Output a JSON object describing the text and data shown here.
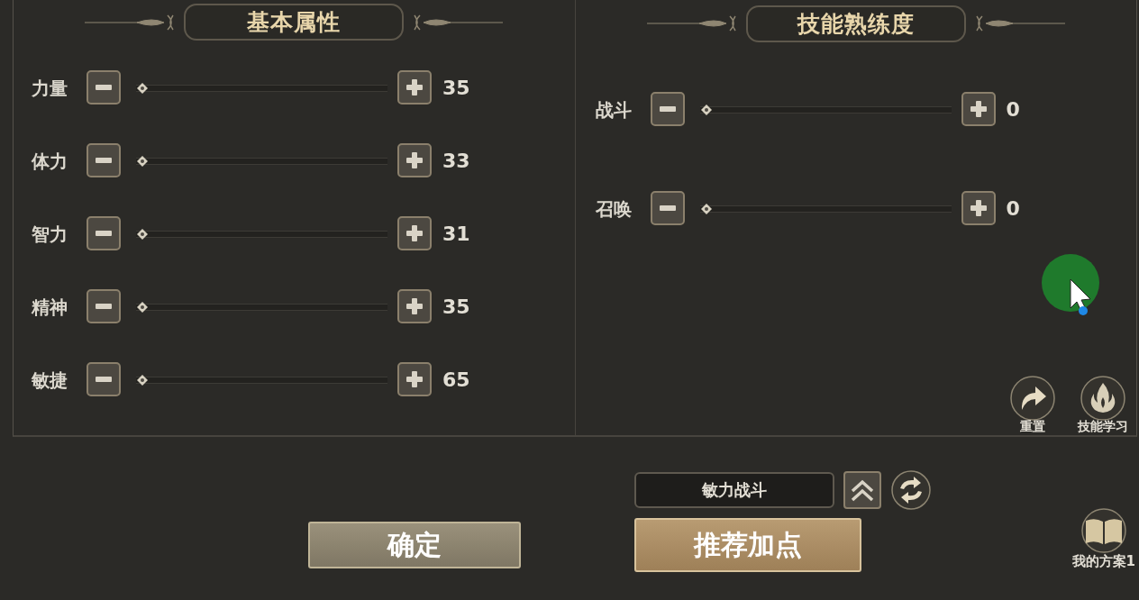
{
  "panels": [
    {
      "kind": "attributes",
      "title": "基本属性",
      "rows": [
        {
          "label": "力量",
          "level": 0,
          "value": "35"
        },
        {
          "label": "体力",
          "level": 0,
          "value": "33"
        },
        {
          "label": "智力",
          "level": 0,
          "value": "31"
        },
        {
          "label": "精神",
          "level": 0,
          "value": "35"
        },
        {
          "label": "敏捷",
          "level": 0,
          "value": "65"
        }
      ]
    },
    {
      "kind": "skills",
      "title": "技能熟练度",
      "rows": [
        {
          "label": "战斗",
          "level": 0,
          "value": "0"
        },
        {
          "label": "召唤",
          "level": 0,
          "value": "0"
        }
      ]
    }
  ],
  "side_actions": [
    {
      "kind": "reset",
      "label": "重置"
    },
    {
      "kind": "learn",
      "label": "技能学习"
    }
  ],
  "plan_field": {
    "value": "敏力战斗"
  },
  "buttons": [
    {
      "kind": "secondary",
      "label": "确定"
    },
    {
      "kind": "primary",
      "label": "推荐加点"
    }
  ],
  "my_plan": {
    "label": "我的方案1"
  }
}
